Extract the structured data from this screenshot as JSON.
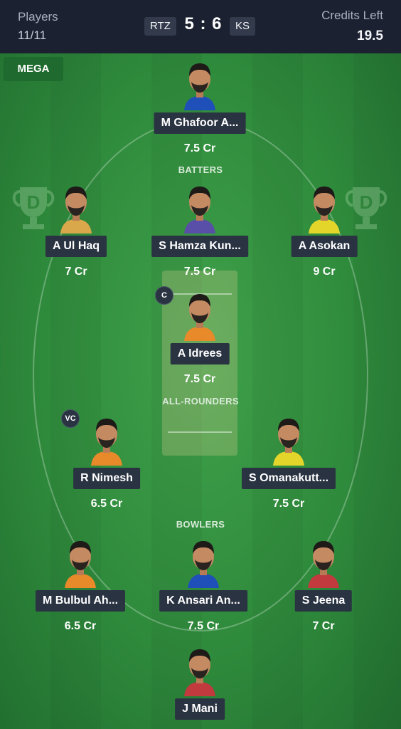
{
  "header": {
    "players_label": "Players",
    "players_value": "11/11",
    "team_left": "RTZ",
    "score": "5 : 6",
    "team_right": "KS",
    "credits_label": "Credits Left",
    "credits_value": "19.5"
  },
  "field": {
    "mode_label": "MEGA",
    "sections": {
      "batters": "BATTERS",
      "all_rounders": "ALL-ROUNDERS",
      "bowlers": "BOWLERS"
    }
  },
  "players": {
    "wk": {
      "name": "M Ghafoor A...",
      "credit": "7.5 Cr",
      "jersey": "#1f4fb8"
    },
    "bat1": {
      "name": "A Ul Haq",
      "credit": "7 Cr",
      "jersey": "#d9a84a"
    },
    "bat2": {
      "name": "S Hamza Kun...",
      "credit": "7.5 Cr",
      "jersey": "#5a4fa8"
    },
    "bat3": {
      "name": "A Asokan",
      "credit": "9 Cr",
      "jersey": "#e4d52a"
    },
    "ar1": {
      "name": "A Idrees",
      "credit": "7.5 Cr",
      "jersey": "#e8892a",
      "badge": "C"
    },
    "ar2": {
      "name": "R Nimesh",
      "credit": "6.5 Cr",
      "jersey": "#e8892a",
      "badge": "VC"
    },
    "ar3": {
      "name": "S Omanakutt...",
      "credit": "7.5 Cr",
      "jersey": "#e4d52a"
    },
    "bowl1": {
      "name": "M Bulbul Ah...",
      "credit": "6.5 Cr",
      "jersey": "#e8892a"
    },
    "bowl2": {
      "name": "K Ansari An...",
      "credit": "7.5 Cr",
      "jersey": "#1f4fb8"
    },
    "bowl3": {
      "name": "S Jeena",
      "credit": "7 Cr",
      "jersey": "#c2393e"
    },
    "bowl4": {
      "name": "J Mani",
      "jersey": "#c2393e"
    }
  }
}
